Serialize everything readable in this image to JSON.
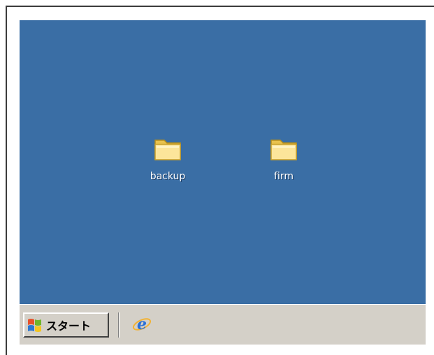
{
  "desktop": {
    "background_color": "#3a6ea5",
    "icons": [
      {
        "label": "backup",
        "icon": "folder-icon"
      },
      {
        "label": "firm",
        "icon": "folder-icon"
      }
    ]
  },
  "taskbar": {
    "start_label": "スタート",
    "start_icon": "windows-logo-icon",
    "quick_launch": [
      {
        "icon": "internet-explorer-icon"
      }
    ]
  }
}
